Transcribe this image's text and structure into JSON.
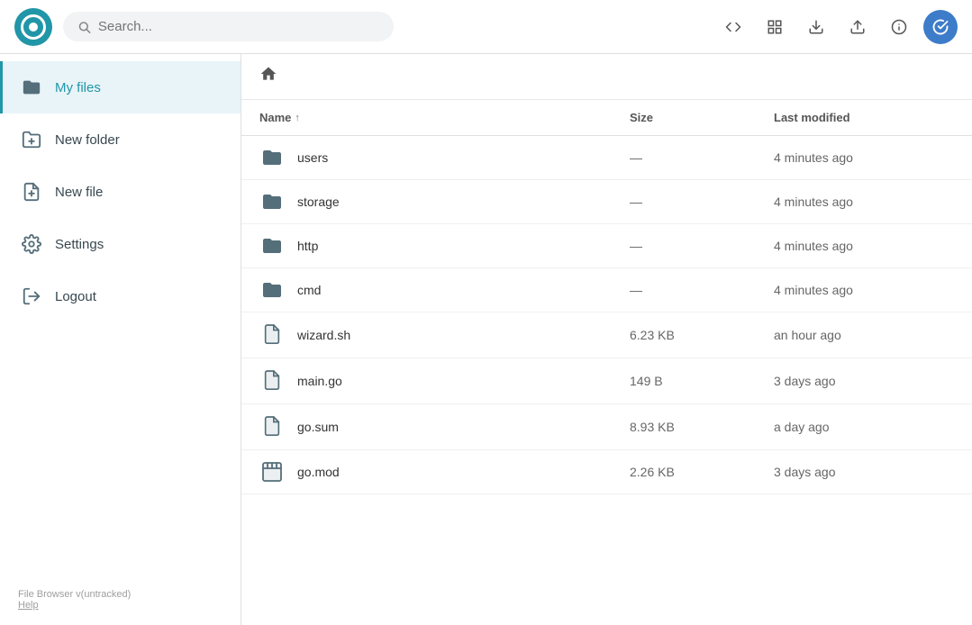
{
  "header": {
    "search_placeholder": "Search...",
    "logo_alt": "File Browser Logo"
  },
  "header_icons": [
    {
      "name": "code-icon",
      "symbol": "</>",
      "label": "Code view",
      "active": false
    },
    {
      "name": "grid-icon",
      "symbol": "⊞",
      "label": "Grid view",
      "active": false
    },
    {
      "name": "download-icon",
      "symbol": "⬇",
      "label": "Download",
      "active": false
    },
    {
      "name": "upload-icon",
      "symbol": "⬆",
      "label": "Upload",
      "active": false
    },
    {
      "name": "info-icon",
      "symbol": "ℹ",
      "label": "Info",
      "active": false
    },
    {
      "name": "check-icon",
      "symbol": "✔",
      "label": "Select all",
      "active": false
    }
  ],
  "sidebar": {
    "items": [
      {
        "id": "my-files",
        "label": "My files",
        "icon": "folder",
        "active": true
      },
      {
        "id": "new-folder",
        "label": "New folder",
        "icon": "new-folder",
        "active": false
      },
      {
        "id": "new-file",
        "label": "New file",
        "icon": "new-file",
        "active": false
      },
      {
        "id": "settings",
        "label": "Settings",
        "icon": "settings",
        "active": false
      },
      {
        "id": "logout",
        "label": "Logout",
        "icon": "logout",
        "active": false
      }
    ],
    "version_label": "File Browser v(untracked)",
    "help_label": "Help"
  },
  "breadcrumb": {
    "home_icon": "🏠"
  },
  "table": {
    "columns": [
      "Name",
      "Size",
      "Last modified"
    ],
    "sort_column": "Name",
    "rows": [
      {
        "name": "users",
        "type": "folder",
        "size": "—",
        "modified": "4 minutes ago"
      },
      {
        "name": "storage",
        "type": "folder",
        "size": "—",
        "modified": "4 minutes ago"
      },
      {
        "name": "http",
        "type": "folder",
        "size": "—",
        "modified": "4 minutes ago"
      },
      {
        "name": "cmd",
        "type": "folder",
        "size": "—",
        "modified": "4 minutes ago"
      },
      {
        "name": "wizard.sh",
        "type": "file",
        "size": "6.23 KB",
        "modified": "an hour ago"
      },
      {
        "name": "main.go",
        "type": "file",
        "size": "149 B",
        "modified": "3 days ago"
      },
      {
        "name": "go.sum",
        "type": "file",
        "size": "8.93 KB",
        "modified": "a day ago"
      },
      {
        "name": "go.mod",
        "type": "clapperboard",
        "size": "2.26 KB",
        "modified": "3 days ago"
      }
    ]
  }
}
